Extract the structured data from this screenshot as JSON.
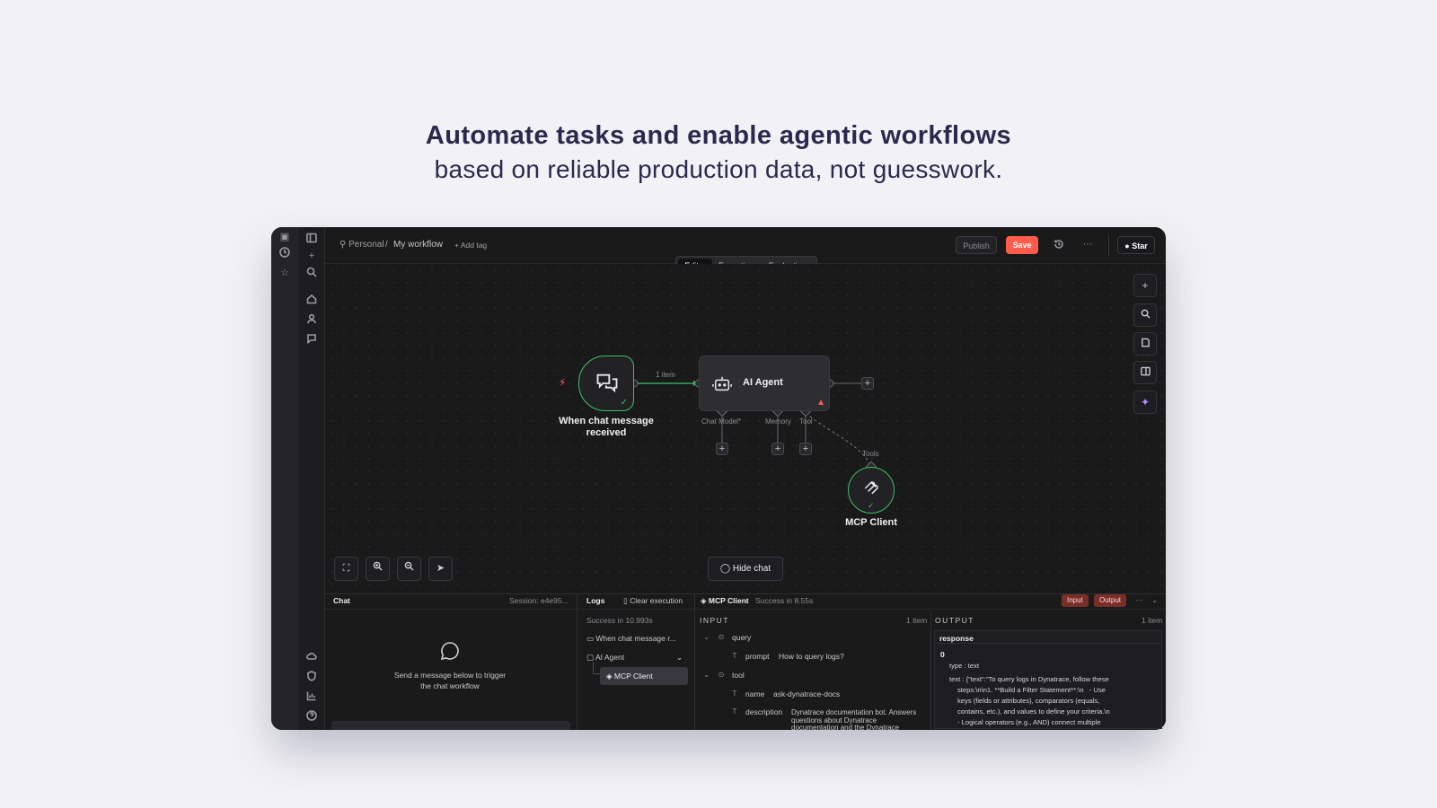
{
  "hero": {
    "title": "Automate tasks and enable agentic workflows",
    "subtitle": "based on reliable production data, not guesswork."
  },
  "topbar": {
    "project": "Personal",
    "workflow": "My workflow",
    "add_tag": "+ Add tag",
    "publish": "Publish",
    "save": "Save",
    "star": "Star"
  },
  "tabs": [
    "Editor",
    "Executions",
    "Evaluations"
  ],
  "canvas": {
    "trigger_label_1": "When chat message",
    "trigger_label_2": "received",
    "connection_label": "1 item",
    "agent_label": "AI Agent",
    "sub_chat_model": "Chat Model*",
    "sub_memory": "Memory",
    "sub_tool": "Tool",
    "tools_label": "Tools",
    "mcp_label": "MCP Client",
    "hide_chat": "Hide chat"
  },
  "chat_panel": {
    "title": "Chat",
    "session": "Session: e4e95...",
    "empty_line1": "Send a message below to trigger",
    "empty_line2": "the chat workflow"
  },
  "logs_panel": {
    "title": "Logs",
    "clear": "Clear execution",
    "status": "Success in 10.993s",
    "items": [
      "When chat message r...",
      "AI Agent",
      "MCP Client"
    ]
  },
  "detail_panel": {
    "node": "MCP Client",
    "status": "Success in 8.55s",
    "input_btn": "Input",
    "output_btn": "Output",
    "input_header": "INPUT",
    "input_count": "1 item",
    "output_header": "OUTPUT",
    "output_count": "1 item",
    "fields": {
      "query": "query",
      "prompt_key": "prompt",
      "prompt_val": "How to query logs?",
      "tool": "tool",
      "name_key": "name",
      "name_val": "ask-dynatrace-docs",
      "desc_key": "description",
      "desc_val_1": "Dynatrace documentation bot. Answers",
      "desc_val_2": "questions about Dynatrace",
      "desc_val_3": "documentation and the Dynatrace"
    },
    "output": {
      "response": "response",
      "index": "0",
      "type_line": "type : text",
      "text_1": "text : {\"text\":\"To query logs in Dynatrace, follow these",
      "text_2": "steps:\\n\\n1. **Build a Filter Statement**:\\n   - Use",
      "text_3": "keys (fields or attributes), comparators (equals,",
      "text_4": "contains, etc.), and values to define your criteria.\\n",
      "text_5": "- Logical operators (e.g., AND) connect multiple"
    }
  },
  "colors": {
    "accent": "#ff5c4c",
    "success": "#3fbf6a",
    "background": "#f2f2f6",
    "hero_text": "#2a2a4e"
  }
}
